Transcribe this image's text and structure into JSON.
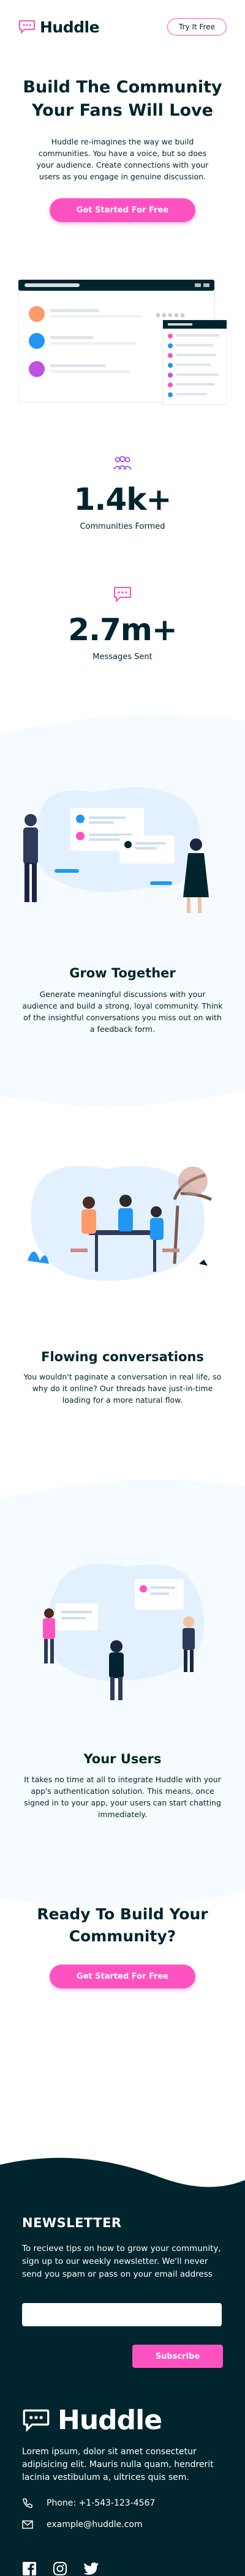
{
  "brand": {
    "name": "Huddle",
    "accent": "#ff52c1",
    "dark": "#00252e",
    "light_bg": "#f5fbff"
  },
  "header": {
    "try_label": "Try It Free"
  },
  "hero": {
    "title_line1": "Build The Community",
    "title_line2": "Your Fans Will Love",
    "description": "Huddle re-imagines the way we build communities. You have a voice, but so does your audience. Create connections with your users as you engage in genuine discussion.",
    "cta_label": "Get Started For Free"
  },
  "stats": [
    {
      "icon": "communities-icon",
      "value": "1.4k+",
      "label": "Communities Formed"
    },
    {
      "icon": "messages-icon",
      "value": "2.7m+",
      "label": "Messages Sent"
    }
  ],
  "features": [
    {
      "title": "Grow Together",
      "text": "Generate meaningful discussions with your audience and build a strong, loyal community. Think of the insightful conversations you miss out on with a feedback form."
    },
    {
      "title": "Flowing conversations",
      "text": "You wouldn't paginate a conversation in real life, so why do it online? Our threads have just-in-time loading for a more natural flow."
    },
    {
      "title": "Your Users",
      "text": "It takes no time at all to integrate Huddle with your app's authentication solution. This means, once signed in to your app, your users can start chatting immediately."
    }
  ],
  "cta": {
    "title_line1": "Ready To Build Your",
    "title_line2": "Community?",
    "button_label": "Get Started For Free"
  },
  "footer": {
    "newsletter_title": "NEWSLETTER",
    "newsletter_text": "To recieve tips on how to grow your community, sign up to our weekly newsletter. We'll never send you spam or pass on your email address",
    "email_placeholder": "",
    "subscribe_label": "Subscribe",
    "brand_name": "Huddle",
    "description": "Lorem ipsum, dolor sit amet consectetur adipisicing elit. Mauris nulla quam, hendrerit lacinia vestibulum a, ultrices quis sem.",
    "phone": "Phone: +1-543-123-4567",
    "email": "example@huddle.com",
    "socials": [
      "facebook-icon",
      "instagram-icon",
      "twitter-icon"
    ]
  }
}
